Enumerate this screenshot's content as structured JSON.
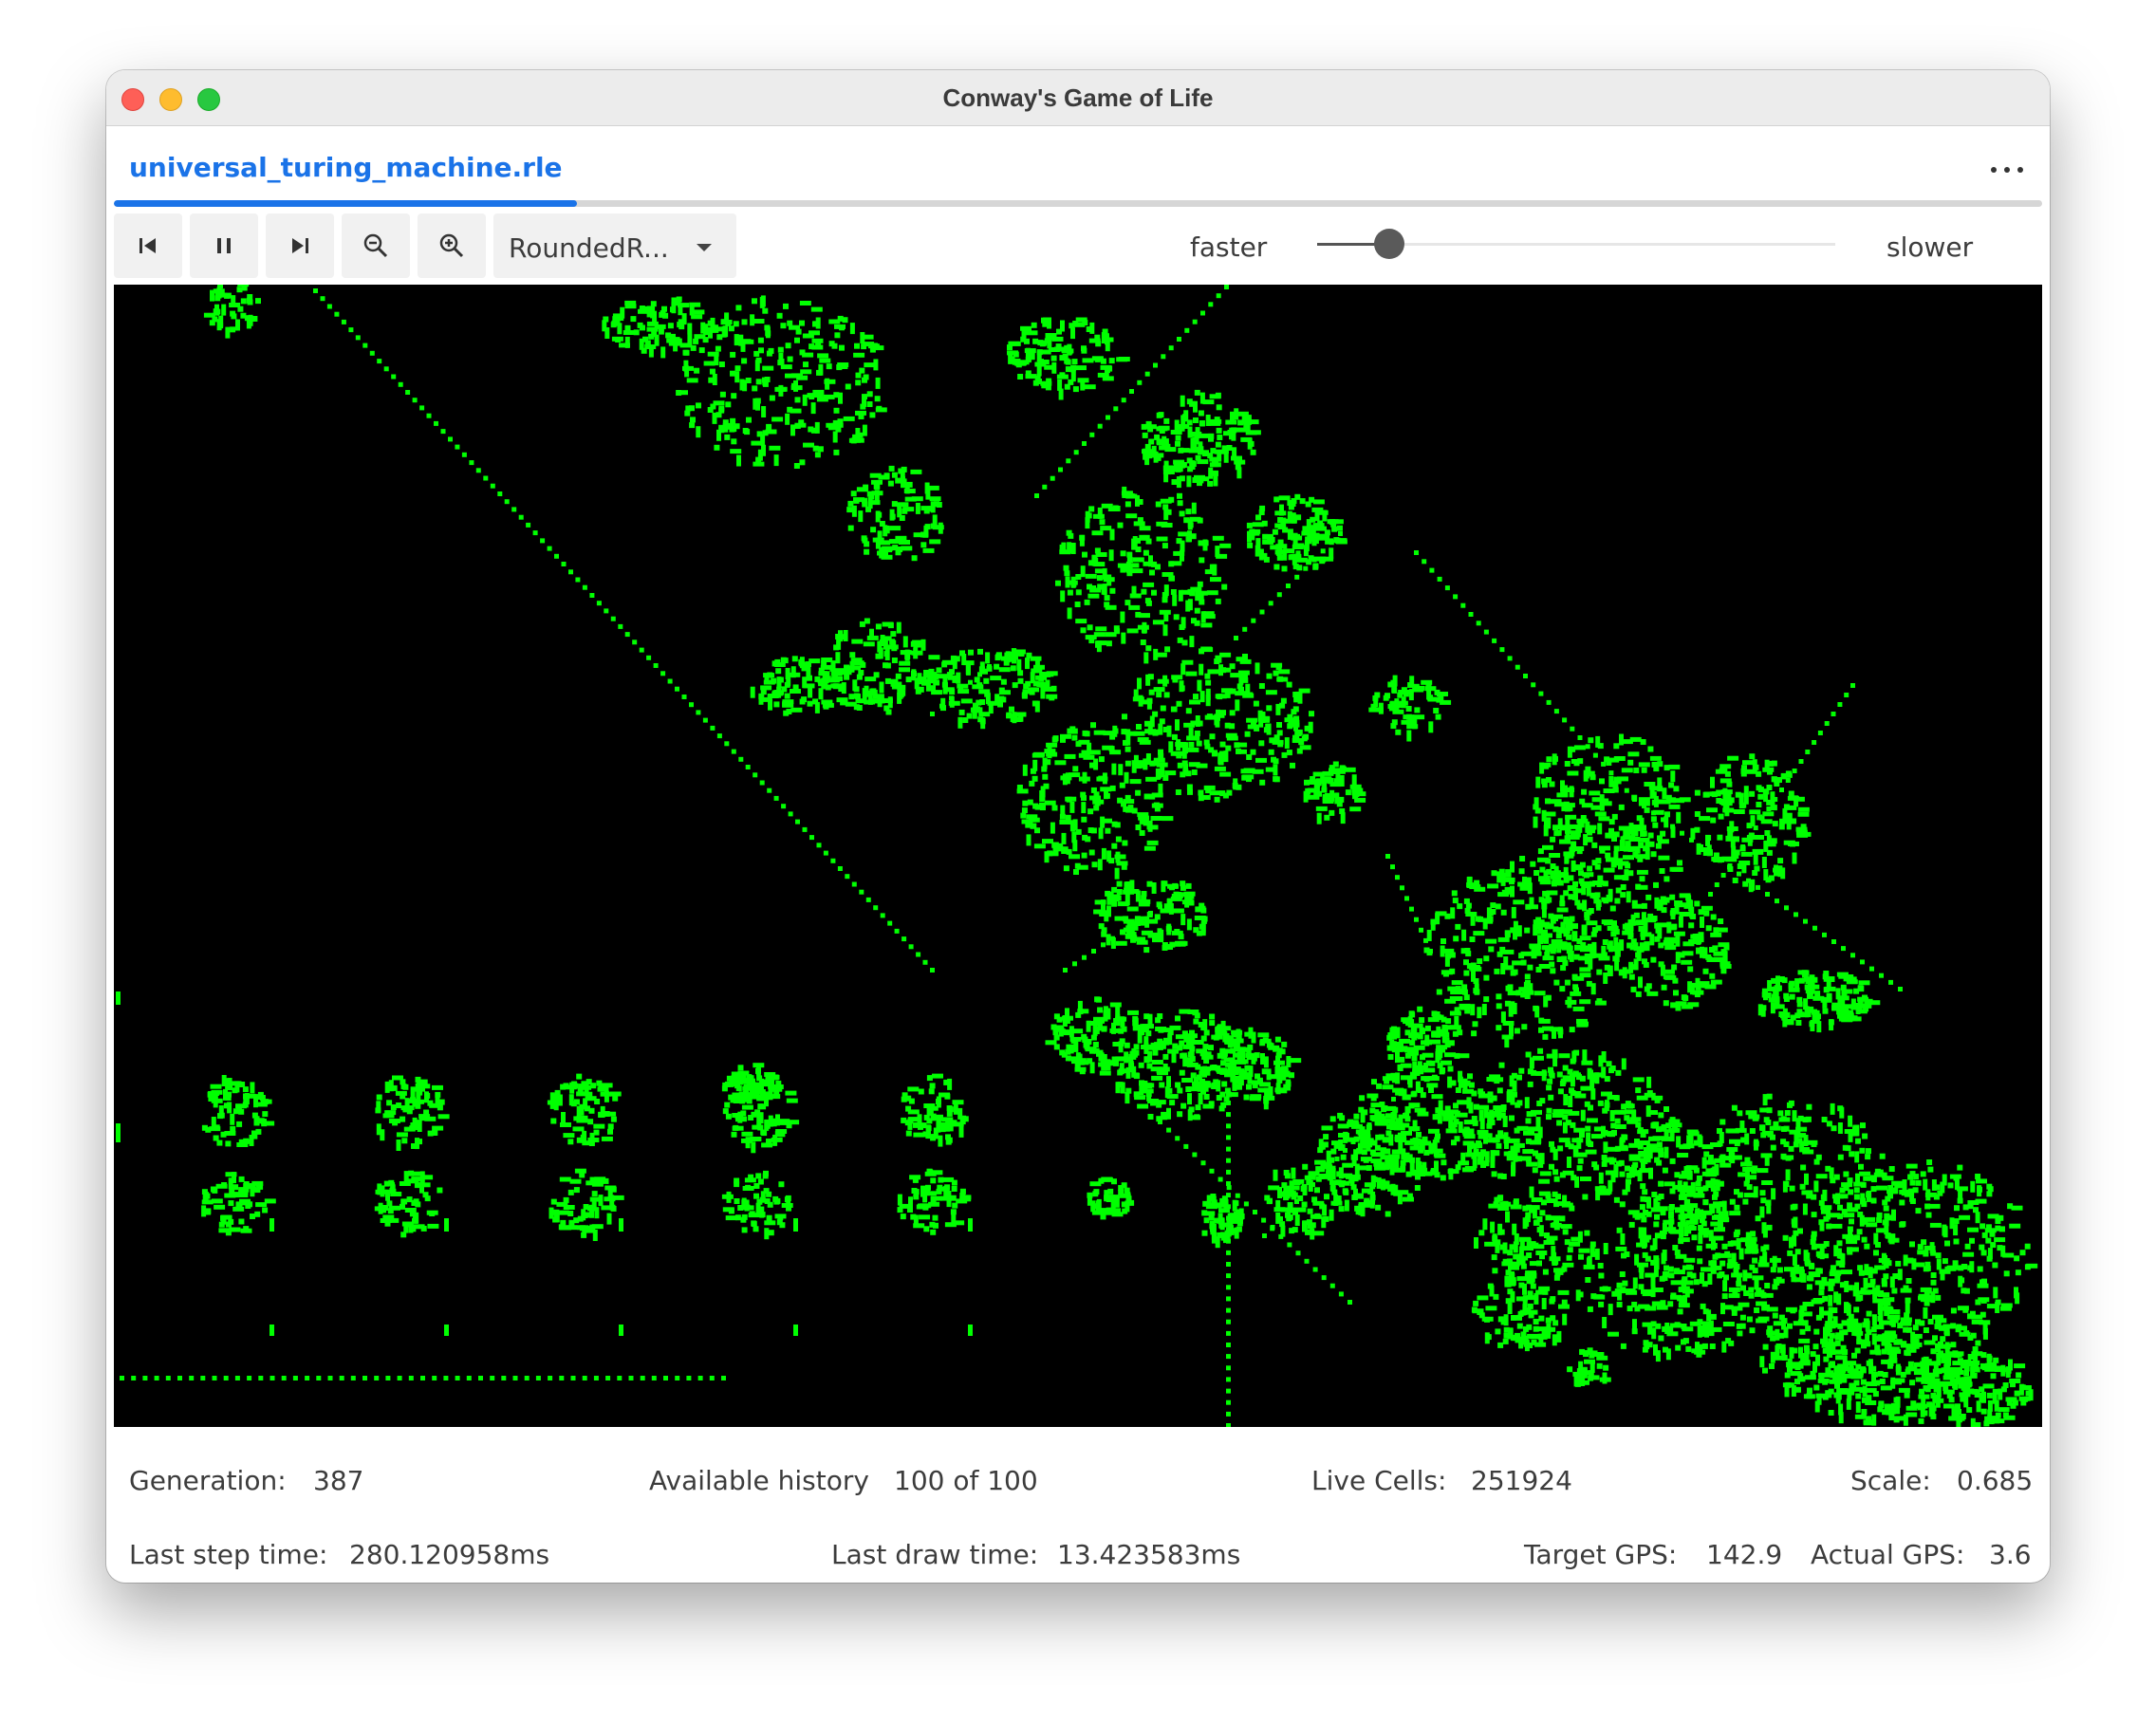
{
  "window": {
    "title": "Conway's Game of Life"
  },
  "file": {
    "name": "universal_turing_machine.rle"
  },
  "history_progress": 0.24,
  "toolbar": {
    "icons": [
      "skip-to-start-icon",
      "pause-icon",
      "step-forward-icon",
      "zoom-out-icon",
      "zoom-in-icon"
    ],
    "renderer_select": "RoundedR...",
    "faster_label": "faster",
    "slower_label": "slower",
    "speed_fraction": 0.14
  },
  "colors": {
    "cell": "#00ff00",
    "background": "#000000",
    "accent": "#1a73e8"
  },
  "status": {
    "generation_label": "Generation:",
    "generation_value": "387",
    "history_label": "Available history",
    "history_value": "100 of 100",
    "live_cells_label": "Live Cells:",
    "live_cells_value": "251924",
    "scale_label": "Scale:",
    "scale_value": "0.685",
    "step_time_label": "Last step time:",
    "step_time_value": "280.120958ms",
    "draw_time_label": "Last draw time:",
    "draw_time_value": "13.423583ms",
    "target_gps_label": "Target GPS:",
    "target_gps_value": "142.9",
    "actual_gps_label": "Actual GPS:",
    "actual_gps_value": "3.6"
  }
}
